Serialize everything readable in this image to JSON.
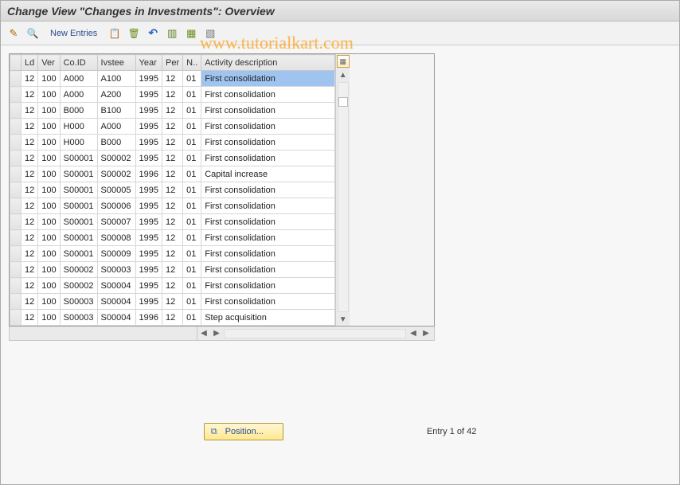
{
  "title": "Change View \"Changes in Investments\": Overview",
  "toolbar": {
    "new_entries_label": "New Entries"
  },
  "watermark": "www.tutorialkart.com",
  "columns": {
    "sel": "",
    "ld": "Ld",
    "ver": "Ver",
    "coid": "Co.ID",
    "ivstee": "Ivstee",
    "year": "Year",
    "per": "Per",
    "n": "N..",
    "activity": "Activity description"
  },
  "rows": [
    {
      "ld": "12",
      "ver": "100",
      "coid": "A000",
      "ivstee": "A100",
      "year": "1995",
      "per": "12",
      "n": "01",
      "activity": "First consolidation",
      "highlight": true
    },
    {
      "ld": "12",
      "ver": "100",
      "coid": "A000",
      "ivstee": "A200",
      "year": "1995",
      "per": "12",
      "n": "01",
      "activity": "First consolidation"
    },
    {
      "ld": "12",
      "ver": "100",
      "coid": "B000",
      "ivstee": "B100",
      "year": "1995",
      "per": "12",
      "n": "01",
      "activity": "First consolidation"
    },
    {
      "ld": "12",
      "ver": "100",
      "coid": "H000",
      "ivstee": "A000",
      "year": "1995",
      "per": "12",
      "n": "01",
      "activity": "First consolidation"
    },
    {
      "ld": "12",
      "ver": "100",
      "coid": "H000",
      "ivstee": "B000",
      "year": "1995",
      "per": "12",
      "n": "01",
      "activity": "First consolidation"
    },
    {
      "ld": "12",
      "ver": "100",
      "coid": "S00001",
      "ivstee": "S00002",
      "year": "1995",
      "per": "12",
      "n": "01",
      "activity": "First consolidation"
    },
    {
      "ld": "12",
      "ver": "100",
      "coid": "S00001",
      "ivstee": "S00002",
      "year": "1996",
      "per": "12",
      "n": "01",
      "activity": "Capital increase"
    },
    {
      "ld": "12",
      "ver": "100",
      "coid": "S00001",
      "ivstee": "S00005",
      "year": "1995",
      "per": "12",
      "n": "01",
      "activity": "First consolidation"
    },
    {
      "ld": "12",
      "ver": "100",
      "coid": "S00001",
      "ivstee": "S00006",
      "year": "1995",
      "per": "12",
      "n": "01",
      "activity": "First consolidation"
    },
    {
      "ld": "12",
      "ver": "100",
      "coid": "S00001",
      "ivstee": "S00007",
      "year": "1995",
      "per": "12",
      "n": "01",
      "activity": "First consolidation"
    },
    {
      "ld": "12",
      "ver": "100",
      "coid": "S00001",
      "ivstee": "S00008",
      "year": "1995",
      "per": "12",
      "n": "01",
      "activity": "First consolidation"
    },
    {
      "ld": "12",
      "ver": "100",
      "coid": "S00001",
      "ivstee": "S00009",
      "year": "1995",
      "per": "12",
      "n": "01",
      "activity": "First consolidation"
    },
    {
      "ld": "12",
      "ver": "100",
      "coid": "S00002",
      "ivstee": "S00003",
      "year": "1995",
      "per": "12",
      "n": "01",
      "activity": "First consolidation"
    },
    {
      "ld": "12",
      "ver": "100",
      "coid": "S00002",
      "ivstee": "S00004",
      "year": "1995",
      "per": "12",
      "n": "01",
      "activity": "First consolidation"
    },
    {
      "ld": "12",
      "ver": "100",
      "coid": "S00003",
      "ivstee": "S00004",
      "year": "1995",
      "per": "12",
      "n": "01",
      "activity": "First consolidation"
    },
    {
      "ld": "12",
      "ver": "100",
      "coid": "S00003",
      "ivstee": "S00004",
      "year": "1996",
      "per": "12",
      "n": "01",
      "activity": "Step acquisition"
    }
  ],
  "footer": {
    "position_label": "Position...",
    "entry_text": "Entry 1 of 42"
  }
}
